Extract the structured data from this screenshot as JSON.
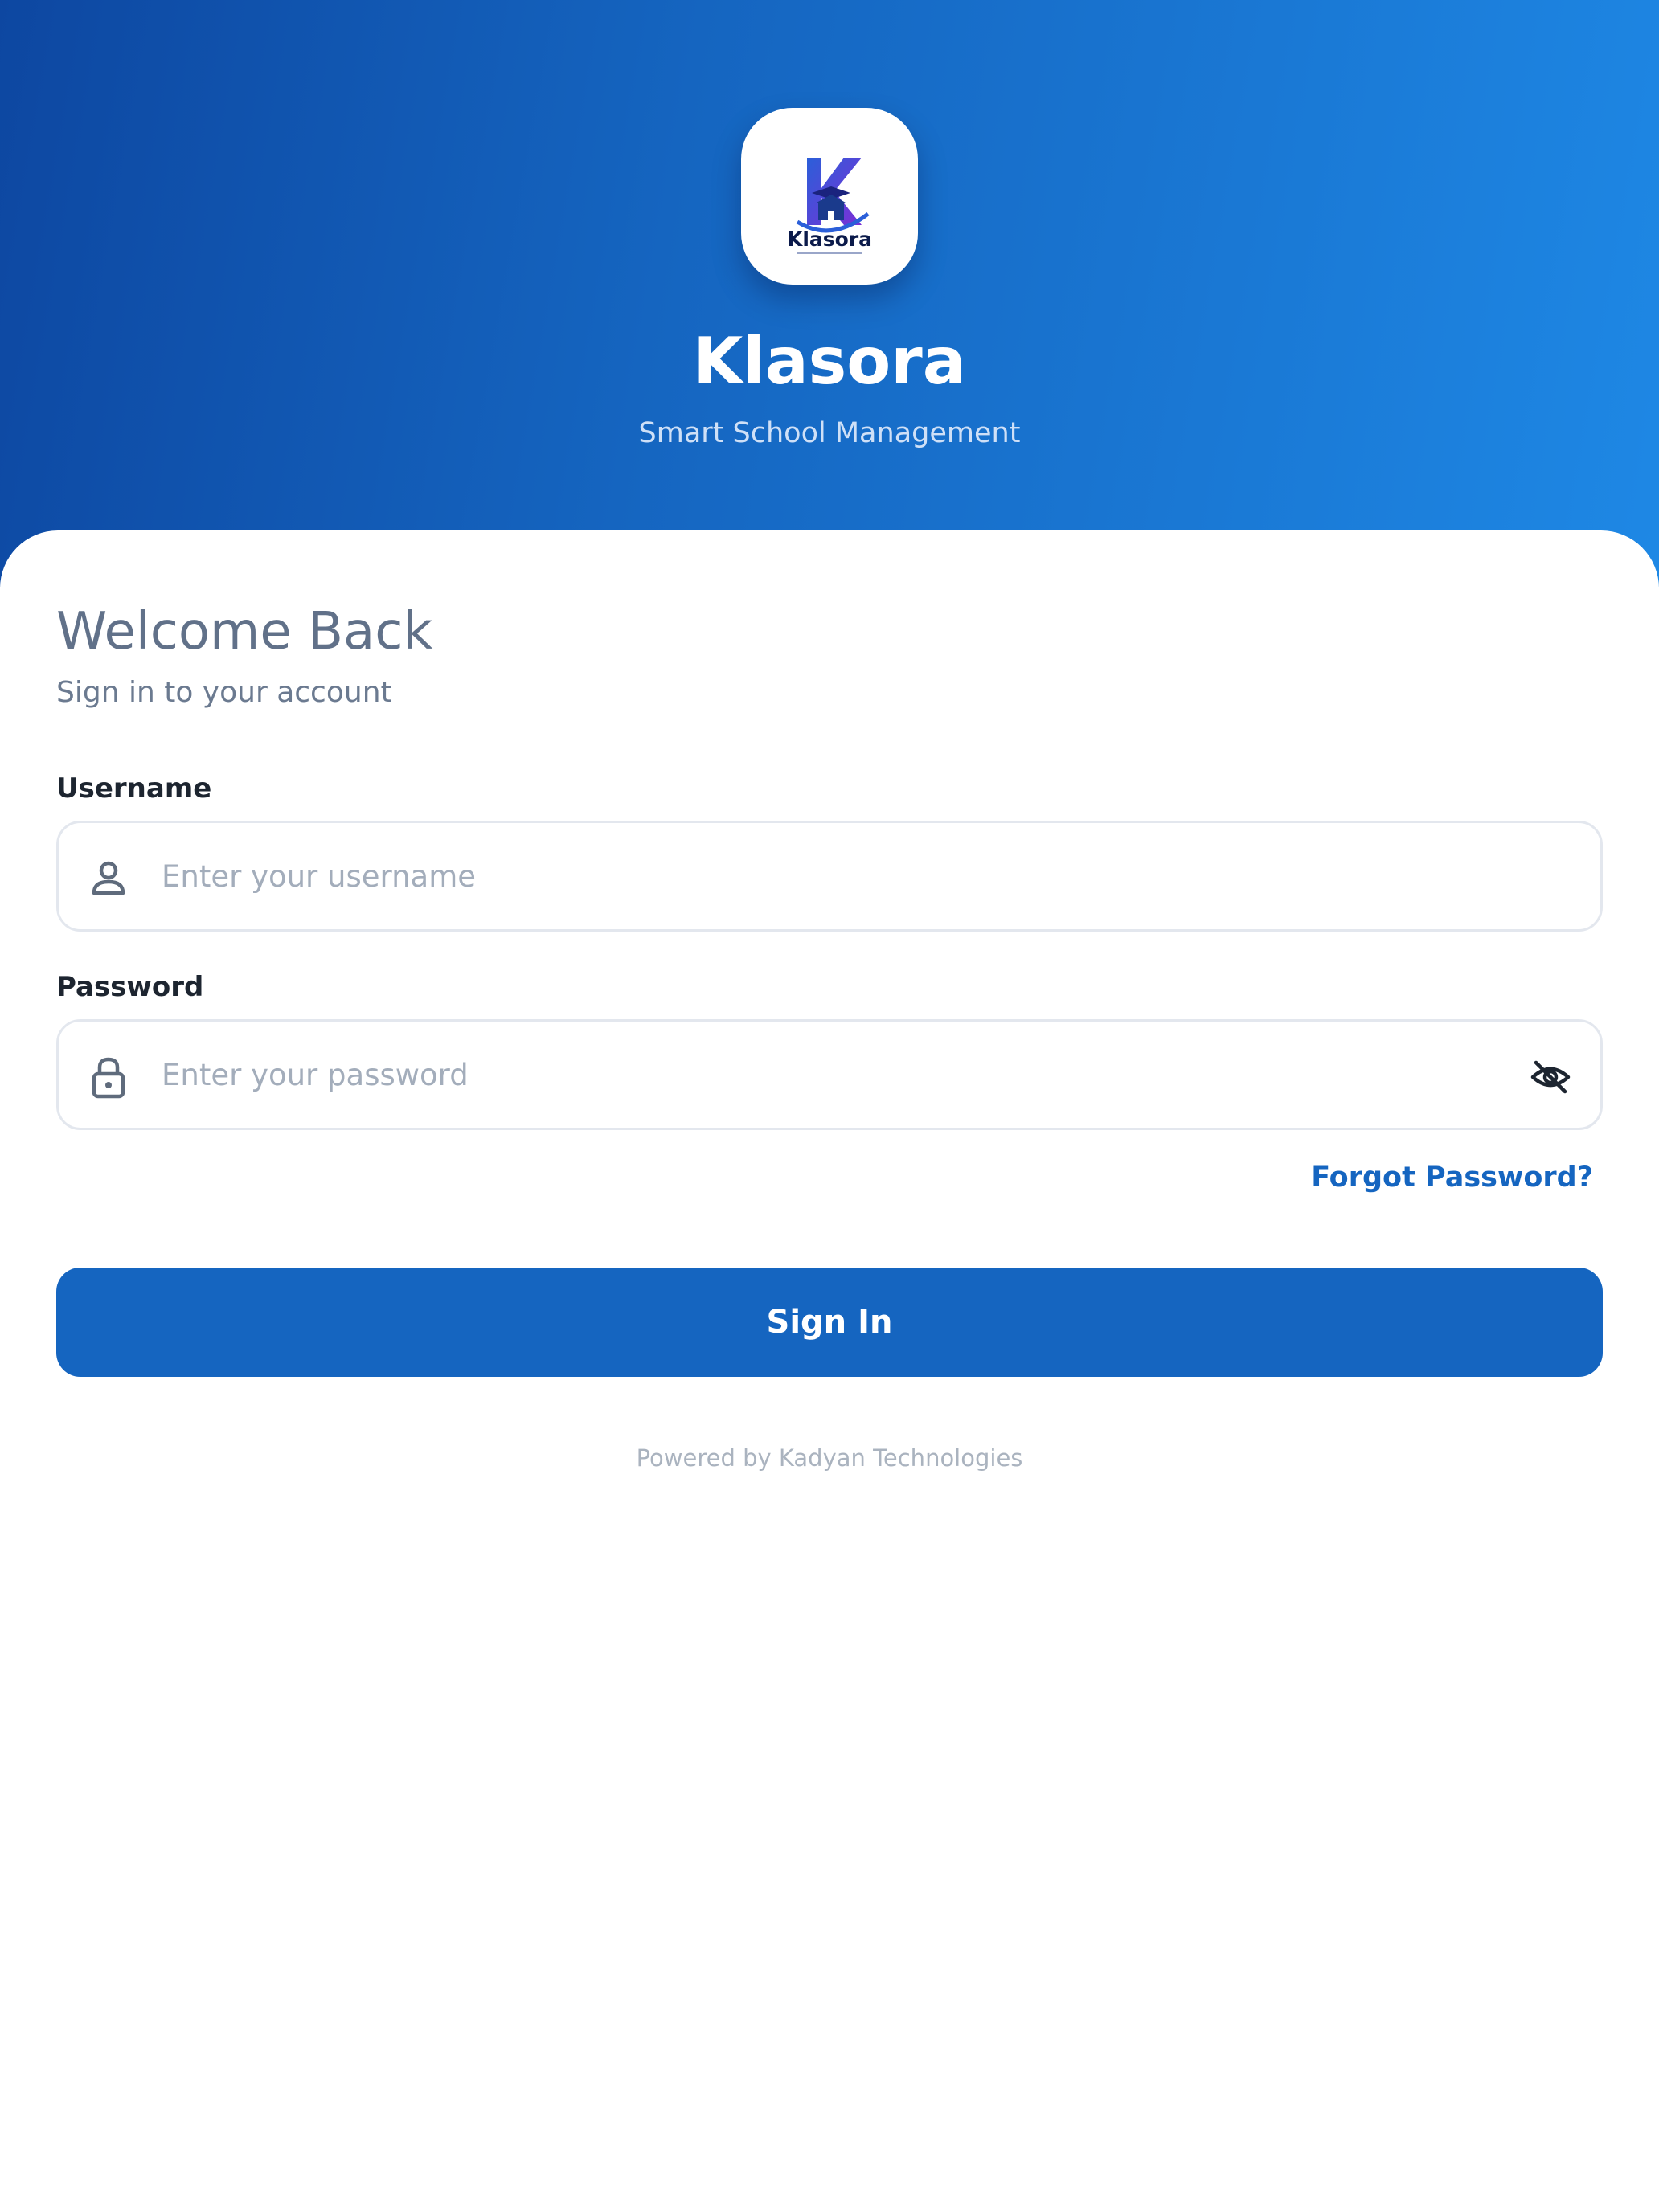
{
  "header": {
    "logo_text": "Klasora",
    "app_title": "Klasora",
    "app_subtitle": "Smart School Management"
  },
  "login": {
    "welcome_title": "Welcome Back",
    "welcome_subtitle": "Sign in to your account",
    "username": {
      "label": "Username",
      "placeholder": "Enter your username",
      "value": "",
      "icon": "person-icon"
    },
    "password": {
      "label": "Password",
      "placeholder": "Enter your password",
      "value": "",
      "icon": "lock-icon",
      "toggle_icon": "eye-off-icon"
    },
    "forgot_label": "Forgot Password?",
    "submit_label": "Sign In"
  },
  "footer": {
    "powered_by": "Powered by Kadyan Technologies"
  },
  "colors": {
    "primary": "#1565c0",
    "header_gradient_start": "#0d47a1",
    "header_gradient_end": "#1e88e5",
    "heading_text": "#617189",
    "label_text": "#1d2530",
    "placeholder_text": "#a3adbb",
    "border": "#e3e7ee"
  }
}
